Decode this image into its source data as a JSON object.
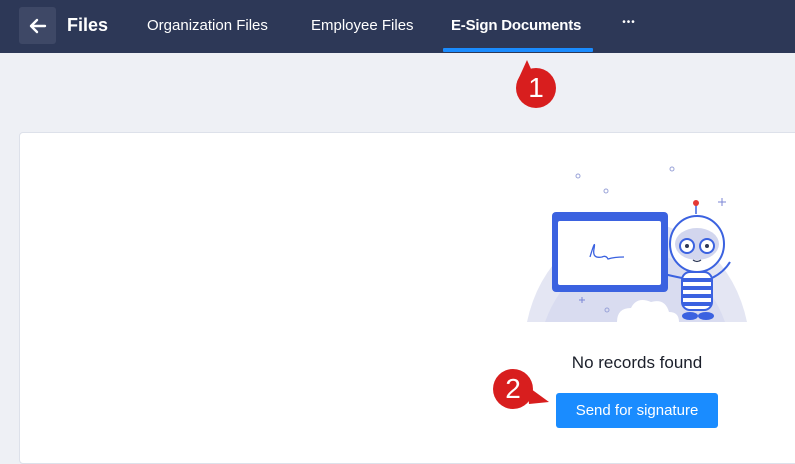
{
  "header": {
    "title": "Files",
    "tabs": [
      {
        "label": "Organization Files",
        "active": false
      },
      {
        "label": "Employee Files",
        "active": false
      },
      {
        "label": "E-Sign Documents",
        "active": true
      }
    ],
    "more_label": "•••"
  },
  "main": {
    "empty_text": "No records found",
    "send_button_label": "Send for signature"
  },
  "annotations": [
    {
      "number": "1"
    },
    {
      "number": "2"
    }
  ],
  "colors": {
    "header_bg": "#2d3857",
    "accent": "#1a8cff",
    "page_bg": "#eef0f5",
    "callout": "#d81e1e"
  },
  "icons": {
    "back": "arrow-left-icon",
    "more": "more-horizontal-icon"
  }
}
